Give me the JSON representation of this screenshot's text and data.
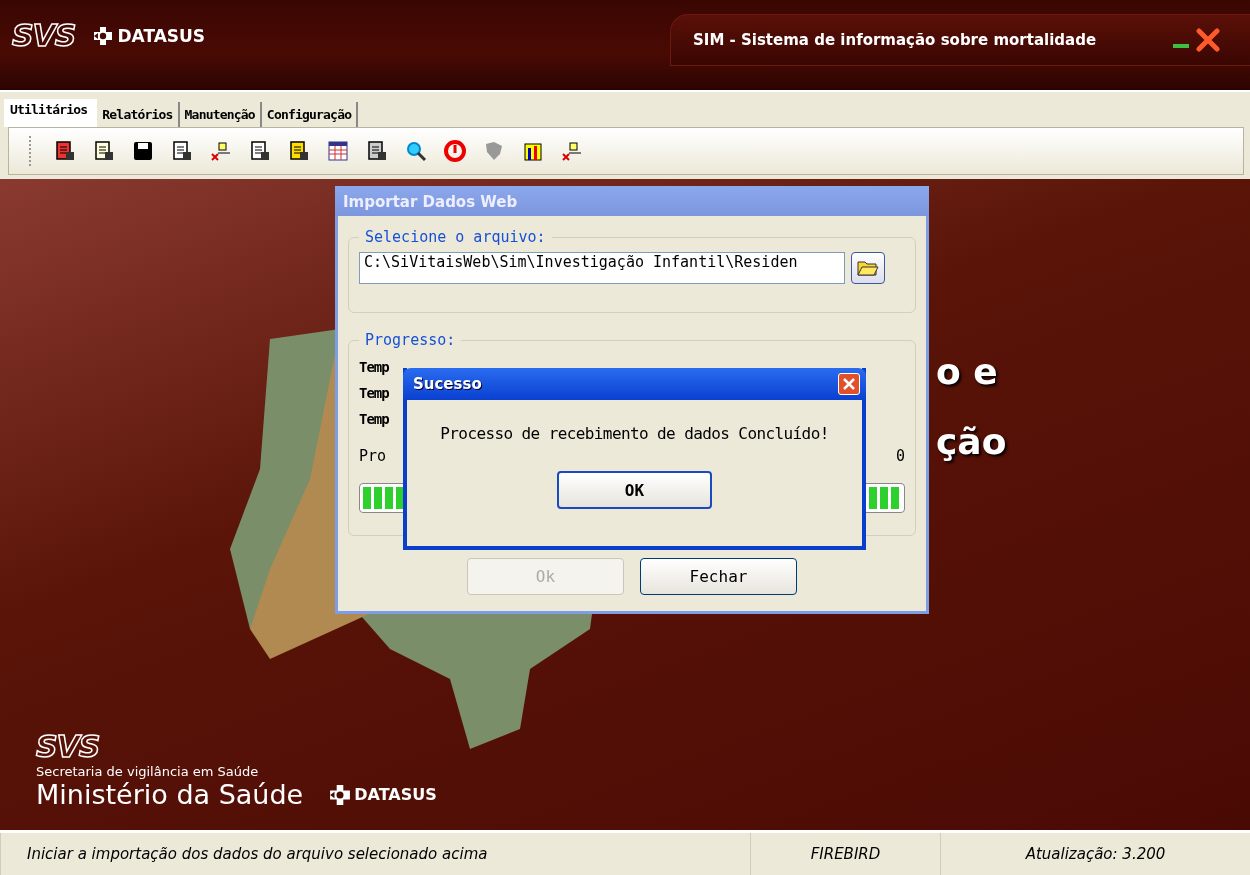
{
  "window": {
    "logo": "SVS",
    "brand": "DATASUS",
    "title": "SIM - Sistema de informação sobre mortalidade"
  },
  "tabs": [
    {
      "label": "Utilitários",
      "selected": true
    },
    {
      "label": "Relatórios",
      "selected": false
    },
    {
      "label": "Manutenção",
      "selected": false
    },
    {
      "label": "Configuração",
      "selected": false
    }
  ],
  "background": {
    "heading_fragments": [
      "o e",
      "ção"
    ],
    "footer": {
      "logo": "SVS",
      "secretariat": "Secretaria de vigilância em Saúde",
      "ministry": "Ministério da Saúde",
      "brand": "DATASUS"
    }
  },
  "import_dialog": {
    "title": "Importar Dados Web",
    "file_group": {
      "legend": "Selecione o arquivo:",
      "value": "C:\\SiVitaisWeb\\Sim\\Investigação Infantil\\Residen"
    },
    "progress_group": {
      "legend": "Progresso:",
      "lines": [
        "Temp",
        "Temp",
        "Temp"
      ],
      "progress_label": "Pro",
      "progress_value": "0",
      "level": 1
    },
    "buttons": [
      {
        "label": "Ok",
        "disabled": true
      },
      {
        "label": "Fechar",
        "disabled": false
      }
    ]
  },
  "message_box": {
    "title": "Sucesso",
    "message": "Processo de recebimento de dados Concluído!",
    "button": "OK"
  },
  "status_bar": [
    "Iniciar a importação dos dados do arquivo selecionado acima",
    "FIREBIRD",
    "Atualização: 3.200"
  ]
}
